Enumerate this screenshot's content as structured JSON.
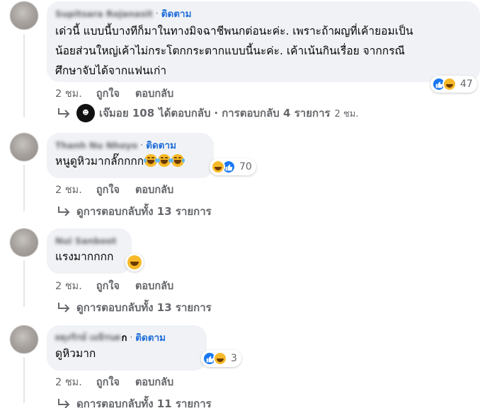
{
  "comments": [
    {
      "author": "Supitsara Rojanasit",
      "follow": "ติดตาม",
      "lines": [
        "เด่วนี้ แบบนี้บางทีก็มาในทางมิจฉาชีพนกต่อนะค่ะ. เพราะถ้าผญที่เค้ายอมเป็น",
        "น้อยส่วนใหญ่เค้าไม่กระโตกกระตากแบบนี้นะค่ะ. เค้าเน้นกินเรื่อย จากกรณี",
        "ศึกษาจับได้จากแฟนเก่า"
      ],
      "reaction_count": "47",
      "reaction_icons": [
        "like-icon",
        "haha-icon"
      ],
      "time": "2 ชม.",
      "like": "ถูกใจ",
      "reply": "ตอบกลับ",
      "replies": {
        "replier": "เจ๊มอย 108",
        "replied": "ได้ตอบกลับ",
        "sep": "·",
        "count_text": "การตอบกลับ 4 รายการ",
        "time": "2 ชม."
      }
    },
    {
      "author": "Thanh Nu Nhoyo",
      "follow": "ติดตาม",
      "lines": [
        "หนูดูหิวมากลั๊กกกก"
      ],
      "reaction_count": "70",
      "reaction_icons": [
        "haha-icon",
        "like-icon"
      ],
      "time": "2 ชม.",
      "like": "ถูกใจ",
      "reply": "ตอบกลับ",
      "replies": {
        "count_text": "ดูการตอบกลับทั้ง 13 รายการ"
      }
    },
    {
      "author": "Nui Sanboot",
      "lines": [
        "แรงมากกกก"
      ],
      "time": "2 ชม.",
      "like": "ถูกใจ",
      "reply": "ตอบกลับ",
      "replies": {
        "count_text": "ดูการตอบกลับทั้ง 13 รายการ"
      }
    },
    {
      "author": "ผดุงรักษ์ เมษิรนต",
      "name_suffix": "ก",
      "follow": "ติดตาม",
      "lines": [
        "ดูหิวมาก"
      ],
      "reaction_count": "3",
      "reaction_icons": [
        "like-icon",
        "haha-icon"
      ],
      "time": "2 ชม.",
      "like": "ถูกใจ",
      "reply": "ตอบกลับ",
      "replies": {
        "count_text": "ดูการตอบกลับทั้ง 11 รายการ"
      }
    }
  ],
  "colors": {
    "bubble": "#f0f2f5",
    "follow": "#216fdb",
    "meta": "#65676b",
    "like": "#1877f2",
    "haha": "#f7b928"
  }
}
